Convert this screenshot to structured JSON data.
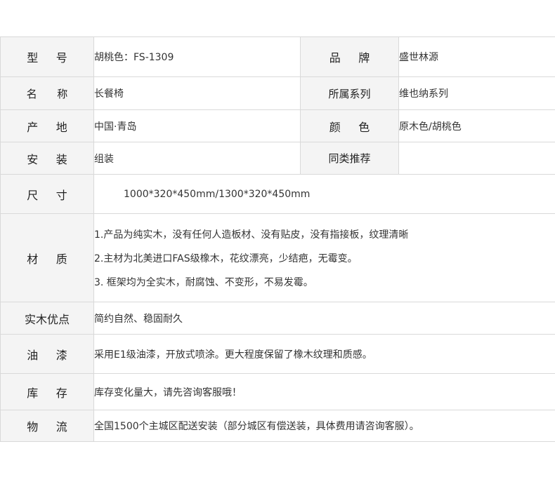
{
  "rows": {
    "model": {
      "label": "型号",
      "value": "胡桃色：FS-1309",
      "label2": "品牌",
      "value2": "盛世林源"
    },
    "name": {
      "label": "名称",
      "value": "长餐椅",
      "label2": "所属系列",
      "value2": "维也纳系列"
    },
    "origin": {
      "label": "产地",
      "value": "中国·青岛",
      "label2": "颜色",
      "value2": "原木色/胡桃色"
    },
    "install": {
      "label": "安装",
      "value": "组装",
      "label2": "同类推荐",
      "value2": ""
    },
    "size": {
      "label": "尺寸",
      "value": "1000*320*450mm/1300*320*450mm"
    },
    "material": {
      "label": "材质",
      "lines": [
        "1.产品为纯实木，没有任何人造板材、没有贴皮，没有指接板，纹理清晰",
        "2.主材为北美进口FAS级橡木，花纹漂亮，少结疤，无霉变。",
        "3. 框架均为全实木，耐腐蚀、不变形，不易发霉。"
      ]
    },
    "advantage": {
      "label": "实木优点",
      "value": "简约自然、稳固耐久"
    },
    "paint": {
      "label": "油漆",
      "value": "采用E1级油漆，开放式喷涂。更大程度保留了橡木纹理和质感。"
    },
    "stock": {
      "label": "库存",
      "value": "库存变化量大，请先咨询客服哦！"
    },
    "logistics": {
      "label": "物流",
      "value": "全国1500个主城区配送安装（部分城区有偿送装，具体费用请咨询客服）。"
    }
  }
}
